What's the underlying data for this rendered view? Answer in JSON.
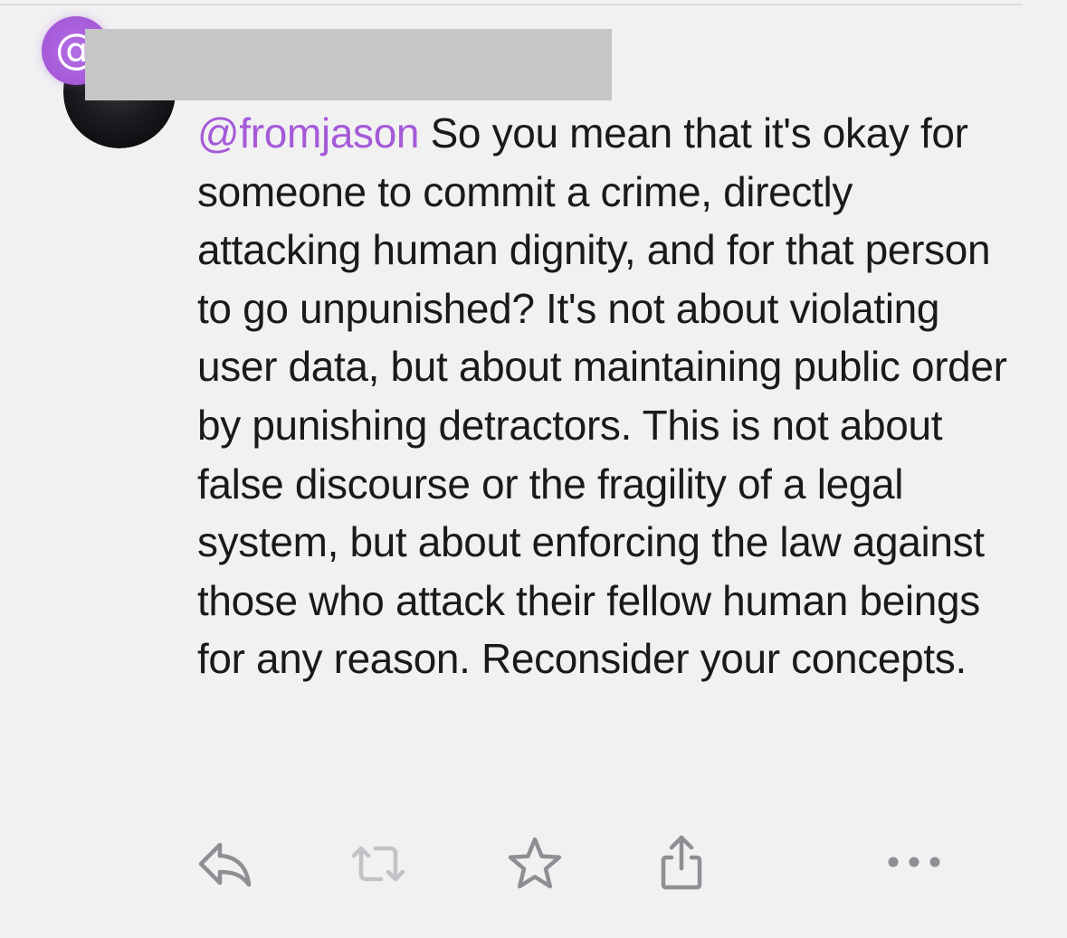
{
  "post": {
    "badge_icon": "at-sign-icon",
    "badge_glyph": "@",
    "badge_color": "#a55ad8",
    "reply_to_handle": "@fromjason",
    "body_text": " So you mean that it's okay for someone to commit a crime, directly attacking human dignity, and for that person to go unpunished? It's not about violating user data, but about maintaining public order by punishing detractors. This is not about false discourse or the fragility of a legal system, but about enforcing the law against those who attack their fellow human beings for any reason. Reconsider your concepts."
  },
  "actions": [
    {
      "icon": "reply-icon"
    },
    {
      "icon": "repost-icon"
    },
    {
      "icon": "star-icon"
    },
    {
      "icon": "share-icon"
    },
    {
      "icon": "more-icon"
    }
  ],
  "colors": {
    "background": "#f1f1f2",
    "text": "#1a1a1a",
    "handle": "#a55ad8",
    "icon": "#8e8e93"
  }
}
